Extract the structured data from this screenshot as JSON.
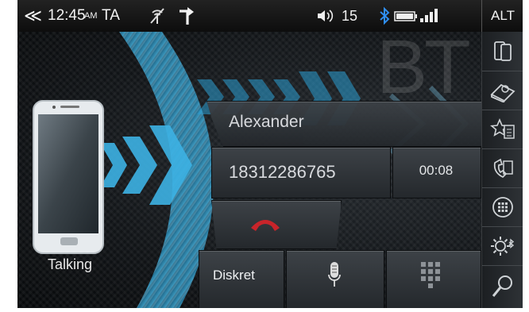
{
  "status_bar": {
    "back_glyph": "≪",
    "time": "12:45",
    "am_pm": "AM",
    "ta": "TA",
    "volume_level": "15",
    "alt_label": "ALT"
  },
  "watermark": "BT",
  "call": {
    "contact_name": "Alexander",
    "phone_number": "18312286765",
    "duration": "00:08",
    "status": "Talking"
  },
  "controls": {
    "diskret_label": "Diskret"
  },
  "icons": {
    "signal_off": "no-signal-icon",
    "route": "turn-arrow-icon",
    "volume": "speaker-icon",
    "bluetooth": "bluetooth-icon",
    "battery": "battery-icon",
    "signal": "signal-bars-icon",
    "hangup": "hang-up-icon",
    "mic": "microphone-icon",
    "keypad": "keypad-icon"
  },
  "sidebar": {
    "items": [
      "phone-transfer-icon",
      "contacts-book-icon",
      "favorites-icon",
      "call-history-icon",
      "dialpad-icon",
      "bt-settings-icon",
      "search-icon"
    ]
  },
  "colors": {
    "accent_blue": "#2fa8d8",
    "hangup_red": "#c8242a",
    "bluetooth": "#2f8ef0"
  }
}
